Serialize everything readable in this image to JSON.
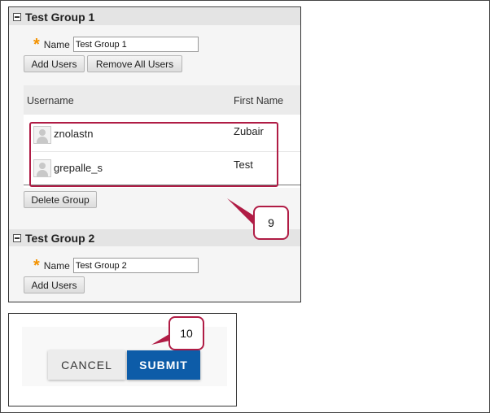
{
  "groups": [
    {
      "title": "Test Group 1",
      "name_label": "Name",
      "name_value": "Test Group 1",
      "add_users_label": "Add Users",
      "remove_all_label": "Remove All Users",
      "table": {
        "col_username": "Username",
        "col_firstname": "First Name",
        "rows": [
          {
            "username": "znolastn",
            "first_name": "Zubair"
          },
          {
            "username": "grepalle_s",
            "first_name": "Test"
          }
        ]
      },
      "delete_label": "Delete Group"
    },
    {
      "title": "Test Group 2",
      "name_label": "Name",
      "name_value": "Test Group 2",
      "add_users_label": "Add Users"
    }
  ],
  "required_marker": "*",
  "callouts": {
    "step9": "9",
    "step10": "10"
  },
  "actions": {
    "cancel": "CANCEL",
    "submit": "SUBMIT"
  },
  "colors": {
    "highlight": "#b01c45",
    "submit": "#0d5ca8",
    "required": "#f39200"
  }
}
